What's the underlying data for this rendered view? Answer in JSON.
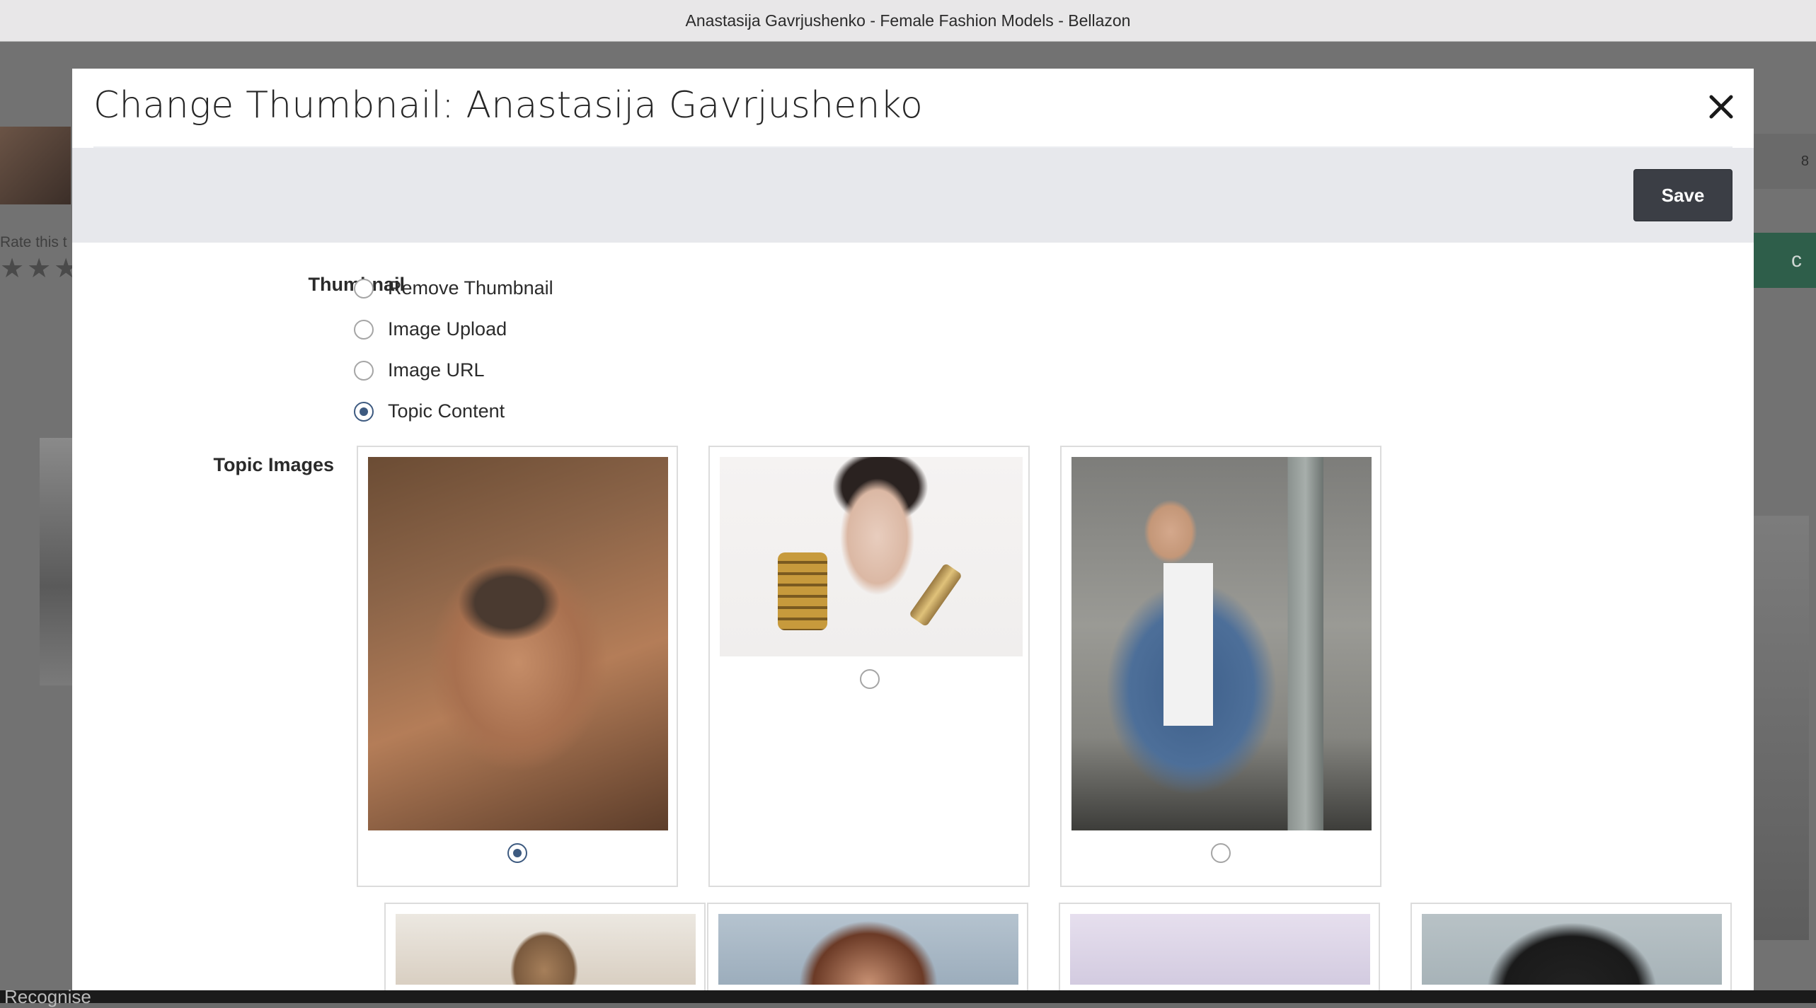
{
  "window": {
    "title": "Anastasija Gavrjushenko - Female Fashion Models - Bellazon"
  },
  "background": {
    "rate_text": "Rate this t",
    "stars": "★★★",
    "right_count": "8",
    "right_green_text": "c",
    "bottom_text": "Recognise"
  },
  "modal": {
    "title": "Change Thumbnail: Anastasija Gavrjushenko",
    "save_label": "Save",
    "thumbnail_label": "Thumbnail",
    "thumbnail_options": [
      {
        "label": "Remove Thumbnail",
        "selected": false
      },
      {
        "label": "Image Upload",
        "selected": false
      },
      {
        "label": "Image URL",
        "selected": false
      },
      {
        "label": "Topic Content",
        "selected": true
      }
    ],
    "topic_images_label": "Topic Images",
    "topic_images": [
      {
        "subject": "close-up portrait",
        "selected": true
      },
      {
        "subject": "portrait with gold bangles",
        "selected": false
      },
      {
        "subject": "street photo denim jacket",
        "selected": false
      },
      {
        "subject": "portrait",
        "selected": false
      },
      {
        "subject": "portrait",
        "selected": false
      },
      {
        "subject": "portrait",
        "selected": false
      },
      {
        "subject": "portrait",
        "selected": false
      }
    ]
  }
}
